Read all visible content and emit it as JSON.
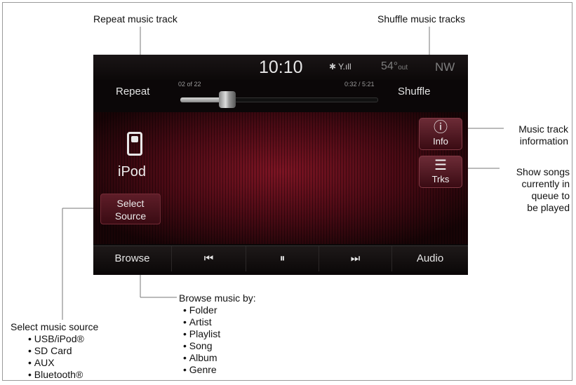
{
  "callouts": {
    "repeat": "Repeat music track",
    "shuffle": "Shuffle music tracks",
    "info": [
      "Music track",
      "information"
    ],
    "trks": [
      "Show songs",
      "currently in",
      "queue to",
      "be played"
    ],
    "select_source": "Select music source",
    "select_source_items": [
      "USB/iPod®",
      "SD Card",
      "AUX",
      "Bluetooth®"
    ],
    "browse": "Browse music by:",
    "browse_items": [
      "Folder",
      "Artist",
      "Playlist",
      "Song",
      "Album",
      "Genre"
    ]
  },
  "screen": {
    "clock": "10:10",
    "signal": "✱ Y.ıll",
    "temp_value": "54°",
    "temp_unit": "out",
    "direction": "NW",
    "repeat_label": "Repeat",
    "shuffle_label": "Shuffle",
    "track_count": "02 of 22",
    "track_time": "0:32 / 5:21",
    "progress_fraction": 0.24,
    "source_name": "iPod",
    "select_source_label": [
      "Select",
      "Source"
    ],
    "info_label": "Info",
    "trks_label": "Trks",
    "info_glyph": "ⓘ",
    "trks_glyph": "☰",
    "bottom": {
      "browse": "Browse",
      "prev": "⏮",
      "pause": "⏸",
      "next": "⏭",
      "audio": "Audio"
    }
  },
  "icons": [
    "ipod-device-icon",
    "bluetooth-icon",
    "signal-bars-icon",
    "info-icon",
    "list-icon",
    "previous-track-icon",
    "pause-icon",
    "next-track-icon"
  ],
  "colors": {
    "accent": "#7d1423",
    "button": "#5e1d28",
    "text": "#e6e6e6"
  }
}
